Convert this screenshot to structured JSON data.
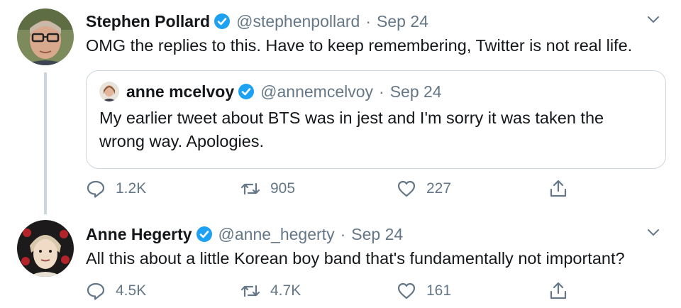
{
  "tweets": [
    {
      "name": "Stephen Pollard",
      "handle": "@stephenpollard",
      "separator": "·",
      "date": "Sep 24",
      "text": "OMG the replies to this. Have to keep remembering, Twitter is not real life.",
      "quote": {
        "name": "anne mcelvoy",
        "handle": "@annemcelvoy",
        "separator": "·",
        "date": "Sep 24",
        "text": "My earlier tweet about BTS was in jest and I'm sorry it was taken the wrong way. Apologies."
      },
      "replies": "1.2K",
      "retweets": "905",
      "likes": "227"
    },
    {
      "name": "Anne Hegerty",
      "handle": "@anne_hegerty",
      "separator": "·",
      "date": "Sep 24",
      "text": "All this about a little Korean boy band that's fundamentally not important?",
      "replies": "4.5K",
      "retweets": "4.7K",
      "likes": "161"
    }
  ],
  "icons": {
    "verified": "verified-badge-icon",
    "caret": "chevron-down-icon",
    "reply": "reply-icon",
    "retweet": "retweet-icon",
    "like": "heart-icon",
    "share": "share-icon"
  },
  "colors": {
    "verified": "#1da1f2",
    "secondary_text": "#657786",
    "border": "#ccd6dd"
  }
}
